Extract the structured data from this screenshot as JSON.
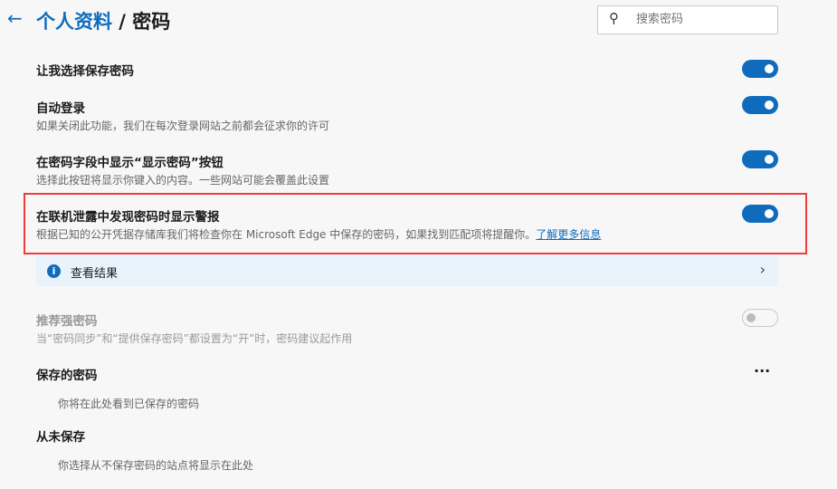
{
  "header": {
    "crumb": "个人资料",
    "sep": " / ",
    "title": "密码",
    "search_placeholder": "搜索密码"
  },
  "settings": [
    {
      "title": "让我选择保存密码",
      "on": true
    },
    {
      "title": "自动登录",
      "desc": "如果关闭此功能，我们在每次登录网站之前都会征求你的许可",
      "on": true
    },
    {
      "title": "在密码字段中显示“显示密码”按钮",
      "desc": "选择此按钮将显示你键入的内容。一些网站可能会覆盖此设置",
      "on": true
    },
    {
      "title": "在联机泄露中发现密码时显示警报",
      "desc": "根据已知的公开凭据存储库我们将检查你在 Microsoft Edge 中保存的密码，如果找到匹配项将提醒你。",
      "link": "了解更多信息",
      "on": true
    },
    {
      "title": "推荐强密码",
      "desc": "当“密码同步”和“提供保存密码”都设置为“开”时，密码建议起作用",
      "on": false
    }
  ],
  "info": {
    "label": "查看结果"
  },
  "saved": {
    "title": "保存的密码",
    "empty": "你将在此处看到已保存的密码",
    "more": "···"
  },
  "never": {
    "title": "从未保存",
    "empty": "你选择从不保存密码的站点将显示在此处"
  }
}
